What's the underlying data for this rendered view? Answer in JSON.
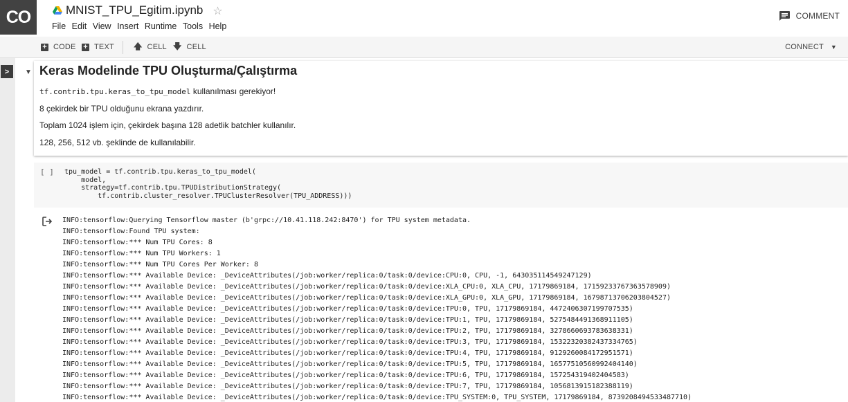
{
  "app": {
    "logo_text": "CO",
    "notebook_title": "MNIST_TPU_Egitim.ipynb",
    "star_icon": "star-outline-icon"
  },
  "menu": [
    "File",
    "Edit",
    "View",
    "Insert",
    "Runtime",
    "Tools",
    "Help"
  ],
  "header": {
    "comment_label": "COMMENT"
  },
  "toolbar": {
    "code_label": "CODE",
    "text_label": "TEXT",
    "cell_up_label": "CELL",
    "cell_down_label": "CELL",
    "connect_label": "CONNECT"
  },
  "text_cell": {
    "title": "Keras Modelinde TPU Oluşturma/Çalıştırma",
    "line1_code": "tf.contrib.tpu.keras_to_tpu_model",
    "line1_rest": " kullanılması gerekiyor!",
    "line2": "8 çekirdek bir TPU olduğunu ekrana yazdırır.",
    "line3": "Toplam 1024 işlem için, çekirdek başına 128 adetlik batchler kullanılır.",
    "line4": "128, 256, 512 vb. şeklinde de kullanılabilir."
  },
  "code_cell": {
    "run_indicator": "[ ]",
    "source": "tpu_model = tf.contrib.tpu.keras_to_tpu_model(\n    model,\n    strategy=tf.contrib.tpu.TPUDistributionStrategy(\n        tf.contrib.cluster_resolver.TPUClusterResolver(TPU_ADDRESS)))"
  },
  "output": {
    "lines": [
      "INFO:tensorflow:Querying Tensorflow master (b'grpc://10.41.118.242:8470') for TPU system metadata.",
      "INFO:tensorflow:Found TPU system:",
      "INFO:tensorflow:*** Num TPU Cores: 8",
      "INFO:tensorflow:*** Num TPU Workers: 1",
      "INFO:tensorflow:*** Num TPU Cores Per Worker: 8",
      "INFO:tensorflow:*** Available Device: _DeviceAttributes(/job:worker/replica:0/task:0/device:CPU:0, CPU, -1, 643035114549247129)",
      "INFO:tensorflow:*** Available Device: _DeviceAttributes(/job:worker/replica:0/task:0/device:XLA_CPU:0, XLA_CPU, 17179869184, 17159233767363578909)",
      "INFO:tensorflow:*** Available Device: _DeviceAttributes(/job:worker/replica:0/task:0/device:XLA_GPU:0, XLA_GPU, 17179869184, 16798713706203804527)",
      "INFO:tensorflow:*** Available Device: _DeviceAttributes(/job:worker/replica:0/task:0/device:TPU:0, TPU, 17179869184, 4472406307199707535)",
      "INFO:tensorflow:*** Available Device: _DeviceAttributes(/job:worker/replica:0/task:0/device:TPU:1, TPU, 17179869184, 5275484491368911105)",
      "INFO:tensorflow:*** Available Device: _DeviceAttributes(/job:worker/replica:0/task:0/device:TPU:2, TPU, 17179869184, 3278660693783638331)",
      "INFO:tensorflow:*** Available Device: _DeviceAttributes(/job:worker/replica:0/task:0/device:TPU:3, TPU, 17179869184, 15322320382437334765)",
      "INFO:tensorflow:*** Available Device: _DeviceAttributes(/job:worker/replica:0/task:0/device:TPU:4, TPU, 17179869184, 9129260084172951571)",
      "INFO:tensorflow:*** Available Device: _DeviceAttributes(/job:worker/replica:0/task:0/device:TPU:5, TPU, 17179869184, 16577510560992404140)",
      "INFO:tensorflow:*** Available Device: _DeviceAttributes(/job:worker/replica:0/task:0/device:TPU:6, TPU, 17179869184, 15725431940240458​3)",
      "INFO:tensorflow:*** Available Device: _DeviceAttributes(/job:worker/replica:0/task:0/device:TPU:7, TPU, 17179869184, 1056813915182388119)",
      "INFO:tensorflow:*** Available Device: _DeviceAttributes(/job:worker/replica:0/task:0/device:TPU_SYSTEM:0, TPU_SYSTEM, 17179869184, 8739208494533487710)"
    ]
  },
  "colors": {
    "logo_bg": "#424242",
    "toolbar_bg": "#f5f5f5",
    "rail_bg": "#ececec",
    "code_bg": "#f7f7f7",
    "drive_green": "#0f9d58",
    "drive_yellow": "#f4b400",
    "drive_blue": "#4285f4"
  }
}
